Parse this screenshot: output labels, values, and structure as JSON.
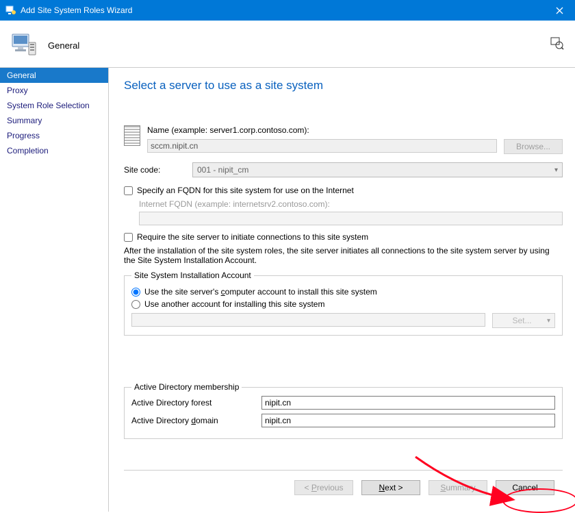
{
  "titlebar": {
    "title": "Add Site System Roles Wizard"
  },
  "header": {
    "label": "General"
  },
  "sidebar": {
    "items": [
      {
        "label": "General",
        "selected": true
      },
      {
        "label": "Proxy"
      },
      {
        "label": "System Role Selection"
      },
      {
        "label": "Summary"
      },
      {
        "label": "Progress"
      },
      {
        "label": "Completion"
      }
    ]
  },
  "content": {
    "heading": "Select a server to use as a site system",
    "name_label": "Name (example: server1.corp.contoso.com):",
    "name_value": "sccm.nipit.cn",
    "browse_label": "Browse...",
    "sitecode_label": "Site code:",
    "sitecode_value": "001 - nipit_cm",
    "fqdn_check_label": "Specify an FQDN for this site system for use on the Internet",
    "internet_fqdn_label": "Internet FQDN (example: internetsrv2.contoso.com):",
    "internet_fqdn_value": "",
    "require_check_label": "Require the site server to initiate connections to this site system",
    "after_text": "After the installation of the site system roles, the site server initiates all connections to the site system server by using the Site System Installation Account.",
    "install_account_legend": "Site System Installation Account",
    "radio1_pre": "Use the site server's ",
    "radio1_u": "c",
    "radio1_post": "omputer account to install this site system",
    "radio2_label": "Use another account for installing this site system",
    "account_value": "",
    "set_label": "Set...",
    "ad_legend": "Active Directory membership",
    "ad_forest_label": "Active Directory forest",
    "ad_forest_value": "nipit.cn",
    "ad_domain_pre": "Active Directory ",
    "ad_domain_u": "d",
    "ad_domain_post": "omain",
    "ad_domain_value": "nipit.cn"
  },
  "buttons": {
    "previous_pre": "< ",
    "previous_u": "P",
    "previous_post": "revious",
    "next_u": "N",
    "next_post": "ext >",
    "summary_u": "S",
    "summary_post": "ummary",
    "cancel": "Cancel"
  }
}
